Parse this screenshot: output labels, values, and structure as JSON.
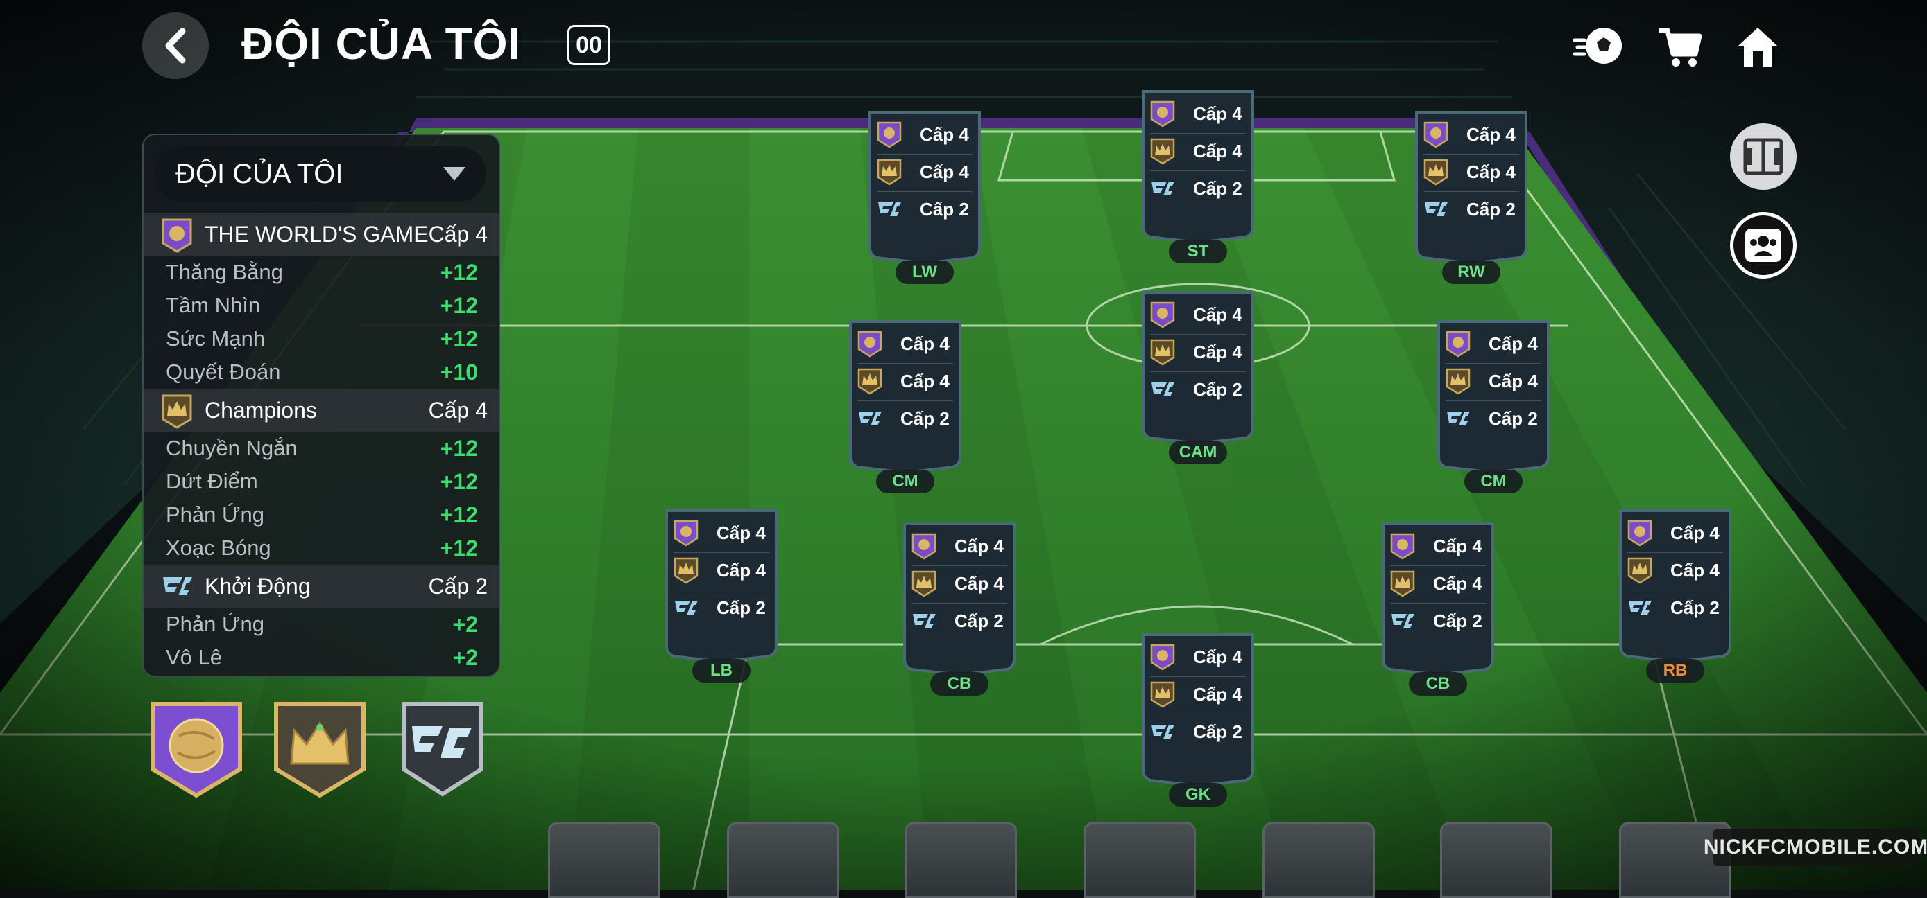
{
  "header": {
    "title": "ĐỘI CỦA TÔI",
    "badge": "00",
    "icons": [
      "back-icon",
      "ball-icon",
      "cart-icon",
      "home-icon"
    ]
  },
  "side_buttons": [
    "formation-icon",
    "team-icon"
  ],
  "panel": {
    "dropdown_label": "ĐỘI CỦA TÔI",
    "groups": [
      {
        "icon": "world-game-icon",
        "name": "THE WORLD'S GAME",
        "level": "Cấp 4",
        "stats": [
          {
            "name": "Thăng Bằng",
            "value": "+12"
          },
          {
            "name": "Tầm Nhìn",
            "value": "+12"
          },
          {
            "name": "Sức Mạnh",
            "value": "+12"
          },
          {
            "name": "Quyết Đoán",
            "value": "+10"
          }
        ]
      },
      {
        "icon": "crown-icon",
        "name": "Champions",
        "level": "Cấp 4",
        "stats": [
          {
            "name": "Chuyền Ngắn",
            "value": "+12"
          },
          {
            "name": "Dứt Điểm",
            "value": "+12"
          },
          {
            "name": "Phản Ứng",
            "value": "+12"
          },
          {
            "name": "Xoạc Bóng",
            "value": "+12"
          }
        ]
      },
      {
        "icon": "fc-icon",
        "name": "Khởi Động",
        "level": "Cấp 2",
        "stats": [
          {
            "name": "Phản Ứng",
            "value": "+2"
          },
          {
            "name": "Vô Lê",
            "value": "+2"
          }
        ]
      }
    ]
  },
  "emblems": [
    "world-game-emblem-icon",
    "champions-crown-emblem-icon",
    "fc-emblem-icon"
  ],
  "cards": [
    {
      "position": "LW",
      "levels": [
        "Cấp 4",
        "Cấp 4",
        "Cấp 2"
      ],
      "pos_color": "#6fe08a"
    },
    {
      "position": "ST",
      "levels": [
        "Cấp 4",
        "Cấp 4",
        "Cấp 2"
      ],
      "pos_color": "#6fe08a"
    },
    {
      "position": "RW",
      "levels": [
        "Cấp 4",
        "Cấp 4",
        "Cấp 2"
      ],
      "pos_color": "#6fe08a"
    },
    {
      "position": "CM",
      "levels": [
        "Cấp 4",
        "Cấp 4",
        "Cấp 2"
      ],
      "pos_color": "#6fe08a"
    },
    {
      "position": "CAM",
      "levels": [
        "Cấp 4",
        "Cấp 4",
        "Cấp 2"
      ],
      "pos_color": "#6fe08a"
    },
    {
      "position": "CM",
      "levels": [
        "Cấp 4",
        "Cấp 4",
        "Cấp 2"
      ],
      "pos_color": "#6fe08a"
    },
    {
      "position": "LB",
      "levels": [
        "Cấp 4",
        "Cấp 4",
        "Cấp 2"
      ],
      "pos_color": "#6fe08a"
    },
    {
      "position": "CB",
      "levels": [
        "Cấp 4",
        "Cấp 4",
        "Cấp 2"
      ],
      "pos_color": "#6fe08a"
    },
    {
      "position": "CB",
      "levels": [
        "Cấp 4",
        "Cấp 4",
        "Cấp 2"
      ],
      "pos_color": "#6fe08a"
    },
    {
      "position": "RB",
      "levels": [
        "Cấp 4",
        "Cấp 4",
        "Cấp 2"
      ],
      "pos_color": "#f08a3a"
    },
    {
      "position": "GK",
      "levels": [
        "Cấp 4",
        "Cấp 4",
        "Cấp 2"
      ],
      "pos_color": "#6fe08a"
    }
  ],
  "watermark": "NICKFCMOBILE.COM",
  "colors": {
    "stat_positive": "#3ddc6f",
    "pitch_green": "#2f7d2a",
    "card_bg": "#1d2a33",
    "card_border": "#4a6a78"
  }
}
